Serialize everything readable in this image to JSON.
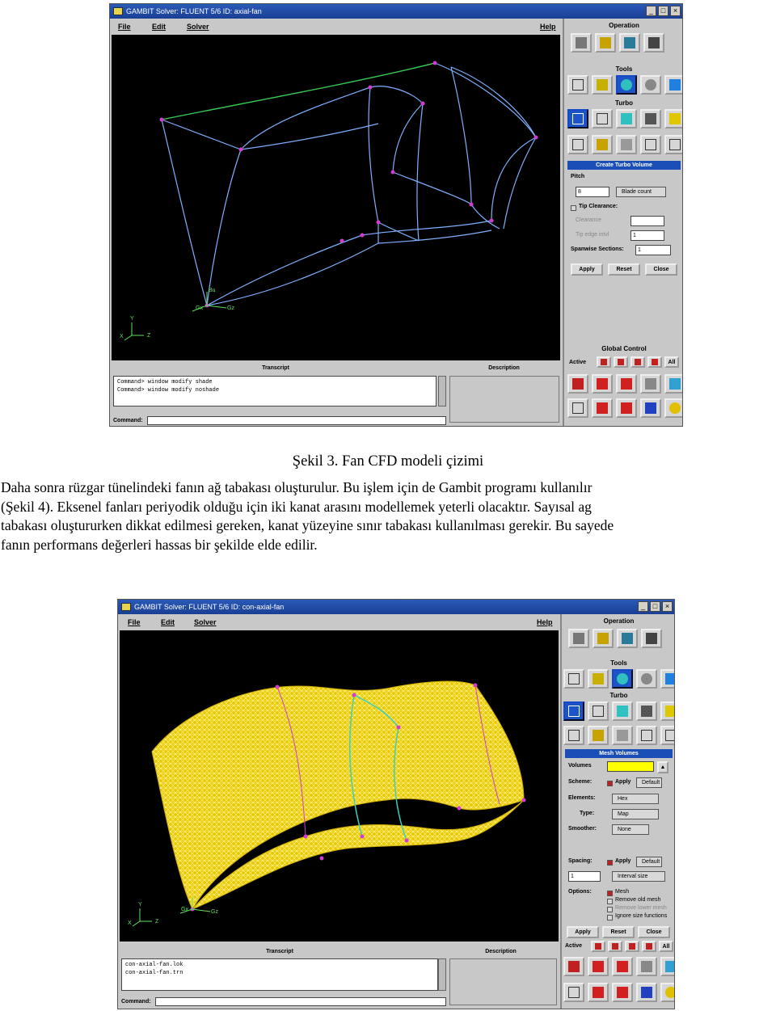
{
  "window1": {
    "title": "GAMBIT   Solver: FLUENT 5/6   ID: axial-fan",
    "menu": [
      "File",
      "Edit",
      "Solver",
      "Help"
    ],
    "axes": {
      "y": "Y",
      "x": "X",
      "z": "Z"
    },
    "node_labels": [
      "Bu",
      "Gx",
      "Gz"
    ],
    "panel": {
      "operation": "Operation",
      "tools": "Tools",
      "turbo": "Turbo",
      "form_title": "Create Turbo Volume",
      "pitch_label": "Pitch",
      "pitch_value": "8",
      "blade_count": "Blade count",
      "tip_clearance": "Tip Clearance:",
      "clearance": "Clearance",
      "tip_edge": "Tip edge intvl",
      "tip_edge_value": "1",
      "spanwise_label": "Spanwise Sections:",
      "spanwise_value": "1",
      "apply": "Apply",
      "reset": "Reset",
      "close": "Close",
      "global_control": "Global Control",
      "active": "Active",
      "all": "All"
    },
    "transcript_title": "Transcript",
    "description_title": "Description",
    "transcript_lines": [
      "Command> window modify shade",
      "Command> window modify noshade"
    ],
    "command_label": "Command:"
  },
  "caption": "Şekil 3. Fan CFD modeli çizimi",
  "paragraph_lines": [
    "Daha sonra rüzgar tünelindeki fanın ağ tabakası oluşturulur. Bu işlem için de Gambit programı kullanılır",
    "(Şekil 4). Eksenel fanları periyodik olduğu için iki kanat arasını modellemek yeterli olacaktır. Sayısal ag",
    "tabakası oluştururken dikkat edilmesi gereken, kanat yüzeyine sınır tabakası kullanılması gerekir. Bu sayede",
    "fanın performans değerleri hassas bir şekilde elde edilir."
  ],
  "window2": {
    "title": "GAMBIT   Solver: FLUENT 5/6   ID: con-axial-fan",
    "menu": [
      "File",
      "Edit",
      "Solver",
      "Help"
    ],
    "axes": {
      "y": "Y",
      "x": "X",
      "z": "Z"
    },
    "node_labels": [
      "Gx",
      "Gz"
    ],
    "panel": {
      "operation": "Operation",
      "tools": "Tools",
      "turbo": "Turbo",
      "form_title": "Mesh Volumes",
      "volumes": "Volumes",
      "scheme": "Scheme:",
      "apply_opt": "Apply",
      "default_opt": "Default",
      "elements": "Elements:",
      "elements_value": "Hex",
      "type": "Type:",
      "type_value": "Map",
      "smoother": "Smoother:",
      "smoother_value": "None",
      "spacing": "Spacing:",
      "spacing_value": "1",
      "interval_size": "Interval size",
      "options": "Options:",
      "opt_mesh": "Mesh",
      "opt_remove_old": "Remove old mesh",
      "opt_remove_lower": "Remove lower mesh",
      "opt_ignore": "Ignore size functions",
      "apply": "Apply",
      "reset": "Reset",
      "close": "Close",
      "active": "Active",
      "all": "All"
    },
    "transcript_title": "Transcript",
    "description_title": "Description",
    "transcript_lines": [
      "con-axial-fan.lok",
      "con-axial-fan.trn"
    ],
    "command_label": "Command:"
  },
  "colors": {
    "titlebar": "#1a3f94",
    "viewport": "#000000",
    "wire": "#7fb0ff",
    "node": "#d23cd2",
    "mesh": "#f0d000",
    "selected_button": "#1c54c8"
  }
}
